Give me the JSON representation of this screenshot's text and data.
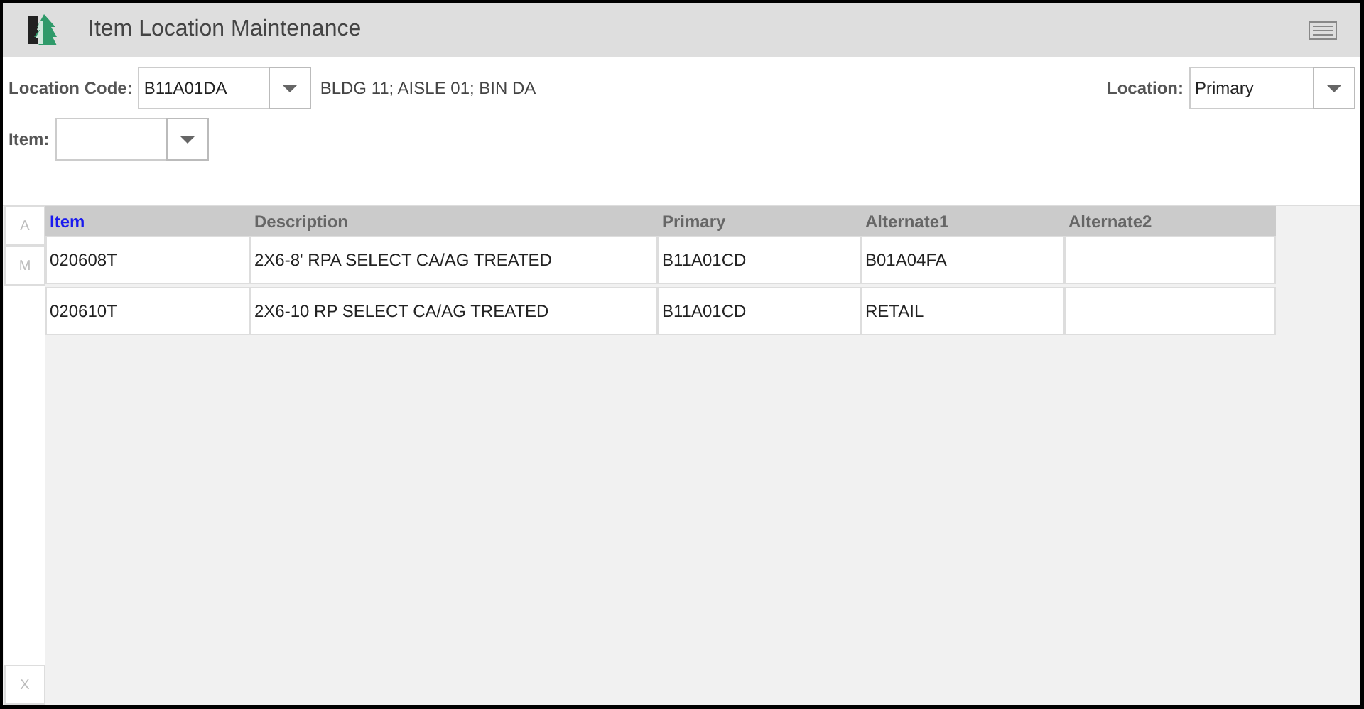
{
  "window": {
    "title": "Item Location Maintenance"
  },
  "form": {
    "location_code": {
      "label": "Location Code:",
      "value": "B11A01DA",
      "description": "BLDG 11; AISLE 01; BIN DA"
    },
    "location": {
      "label": "Location:",
      "value": "Primary"
    },
    "item": {
      "label": "Item:"
    }
  },
  "index_rail": {
    "top": [
      "A",
      "M"
    ],
    "bottom": [
      "X"
    ]
  },
  "table": {
    "columns": [
      {
        "label": "Item",
        "selected": true
      },
      {
        "label": "Description",
        "selected": false
      },
      {
        "label": "Primary",
        "selected": false
      },
      {
        "label": "Alternate1",
        "selected": false
      },
      {
        "label": "Alternate2",
        "selected": false
      }
    ],
    "rows": [
      [
        "020608T",
        "2X6-8' RPA SELECT CA/AG TREATED",
        "B11A01CD",
        "B01A04FA",
        ""
      ],
      [
        "020610T",
        "2X6-10 RP SELECT CA/AG TREATED",
        "B11A01CD",
        "RETAIL",
        ""
      ]
    ]
  }
}
